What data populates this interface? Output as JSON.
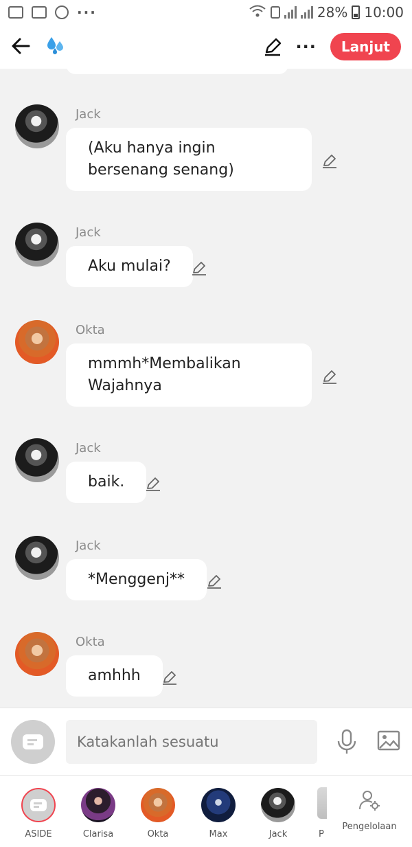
{
  "status_bar": {
    "battery": "28%",
    "time": "10:00",
    "more": "···"
  },
  "header": {
    "lanjut_label": "Lanjut",
    "more_label": "···",
    "title_icon": "water-drops-icon"
  },
  "messages": [
    {
      "sender": "Jack",
      "avatar": "jack",
      "text": "(Aku hanya ingin bersenang senang)"
    },
    {
      "sender": "Jack",
      "avatar": "jack",
      "text": "Aku mulai?"
    },
    {
      "sender": "Okta",
      "avatar": "okta",
      "text": "mmmh*Membalikan Wajahnya"
    },
    {
      "sender": "Jack",
      "avatar": "jack",
      "text": "baik."
    },
    {
      "sender": "Jack",
      "avatar": "jack",
      "text": "*Menggenj**"
    },
    {
      "sender": "Okta",
      "avatar": "okta",
      "text": "amhhh"
    }
  ],
  "composer": {
    "placeholder": "Katakanlah sesuatu"
  },
  "characters": [
    {
      "label": "ASIDE"
    },
    {
      "label": "Clarisa"
    },
    {
      "label": "Okta"
    },
    {
      "label": "Max"
    },
    {
      "label": "Jack"
    },
    {
      "label": "P"
    }
  ],
  "manage": {
    "label": "Pengelolaan"
  },
  "colors": {
    "accent": "#f0444f",
    "background": "#f2f2f2"
  }
}
